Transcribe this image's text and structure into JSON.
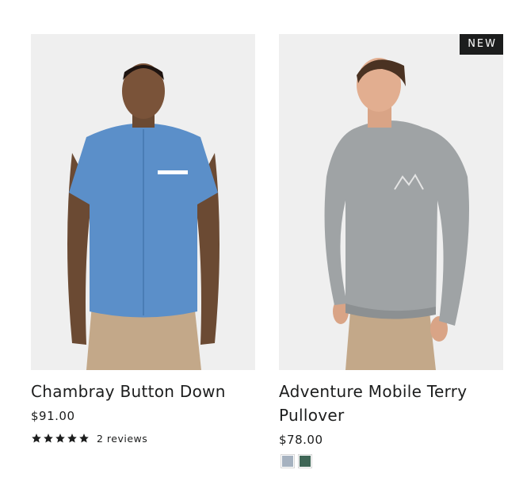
{
  "products": [
    {
      "title": "Chambray Button Down",
      "price": "$91.00",
      "rating": 5,
      "reviews": "2 reviews",
      "image_icon": "man-blue-shirt-photo"
    },
    {
      "badge": "NEW",
      "title": "Adventure Mobile Terry Pullover",
      "price": "$78.00",
      "image_icon": "man-grey-pullover-photo",
      "swatches": [
        {
          "color": "#a6b2c0"
        },
        {
          "color": "#3f6656"
        }
      ]
    }
  ]
}
